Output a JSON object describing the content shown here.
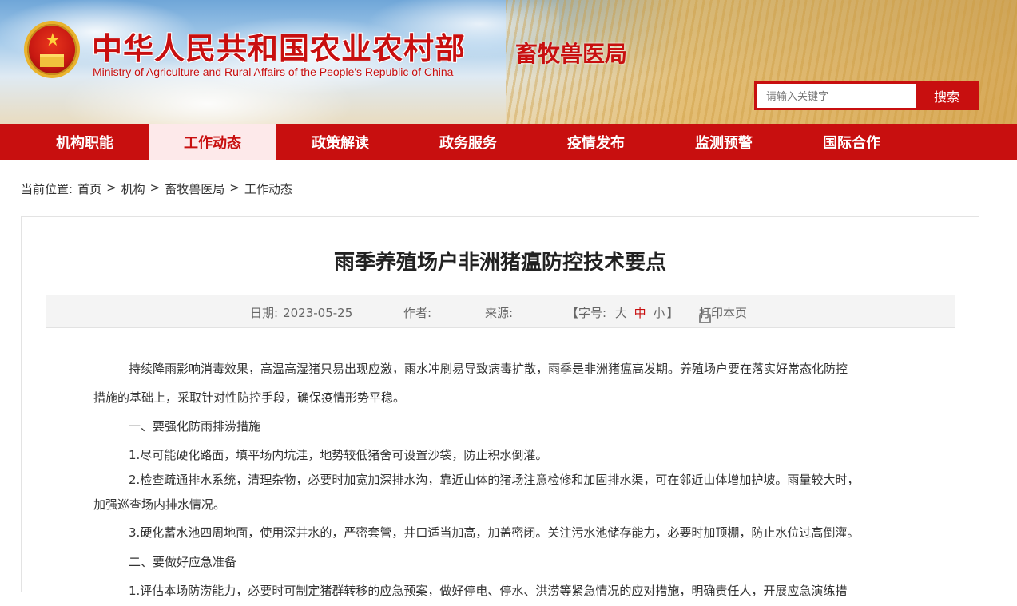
{
  "header": {
    "site_title": "中华人民共和国农业农村部",
    "site_subtitle": "Ministry of Agriculture and Rural Affairs of the People's Republic of China",
    "bureau": "畜牧兽医局",
    "search_placeholder": "请输入关键字",
    "search_button": "搜索"
  },
  "nav": {
    "items": [
      {
        "label": "机构职能"
      },
      {
        "label": "工作动态",
        "active": true
      },
      {
        "label": "政策解读"
      },
      {
        "label": "政务服务"
      },
      {
        "label": "疫情发布"
      },
      {
        "label": "监测预警"
      },
      {
        "label": "国际合作"
      }
    ]
  },
  "breadcrumb": {
    "prefix": "当前位置:",
    "items": [
      "首页",
      "机构",
      "畜牧兽医局",
      "工作动态"
    ],
    "separator": ">"
  },
  "article": {
    "title": "雨季养殖场户非洲猪瘟防控技术要点",
    "meta": {
      "date_label": "日期:",
      "date": "2023-05-25",
      "author_label": "作者:",
      "source_label": "来源:",
      "font_size_open": "【字号:",
      "font_large": "大",
      "font_medium": "中",
      "font_small": "小",
      "font_size_close": "】",
      "print": "打印本页"
    },
    "paragraphs": [
      "持续降雨影响消毒效果，高温高湿猪只易出现应激，雨水冲刷易导致病毒扩散，雨季是非洲猪瘟高发期。养殖场户要在落实好常态化防控",
      "措施的基础上，采取针对性防控手段，确保疫情形势平稳。",
      "一、要强化防雨排涝措施",
      "1.尽可能硬化路面，填平场内坑洼，地势较低猪舍可设置沙袋，防止积水倒灌。",
      "2.检查疏通排水系统，清理杂物，必要时加宽加深排水沟，靠近山体的猪场注意检修和加固排水渠，可在邻近山体增加护坡。雨量较大时，",
      "加强巡查场内排水情况。",
      "3.硬化蓄水池四周地面，使用深井水的，严密套管，井口适当加高，加盖密闭。关注污水池储存能力，必要时加顶棚，防止水位过高倒灌。",
      "二、要做好应急准备",
      "1.评估本场防涝能力，必要时可制定猪群转移的应急预案，做好停电、停水、洪涝等紧急情况的应对措施，明确责任人，开展应急演练措"
    ]
  },
  "colors": {
    "brand_red": "#c80f0f",
    "nav_active_bg": "#fde9ea",
    "meta_bg": "#f4f4f4"
  }
}
